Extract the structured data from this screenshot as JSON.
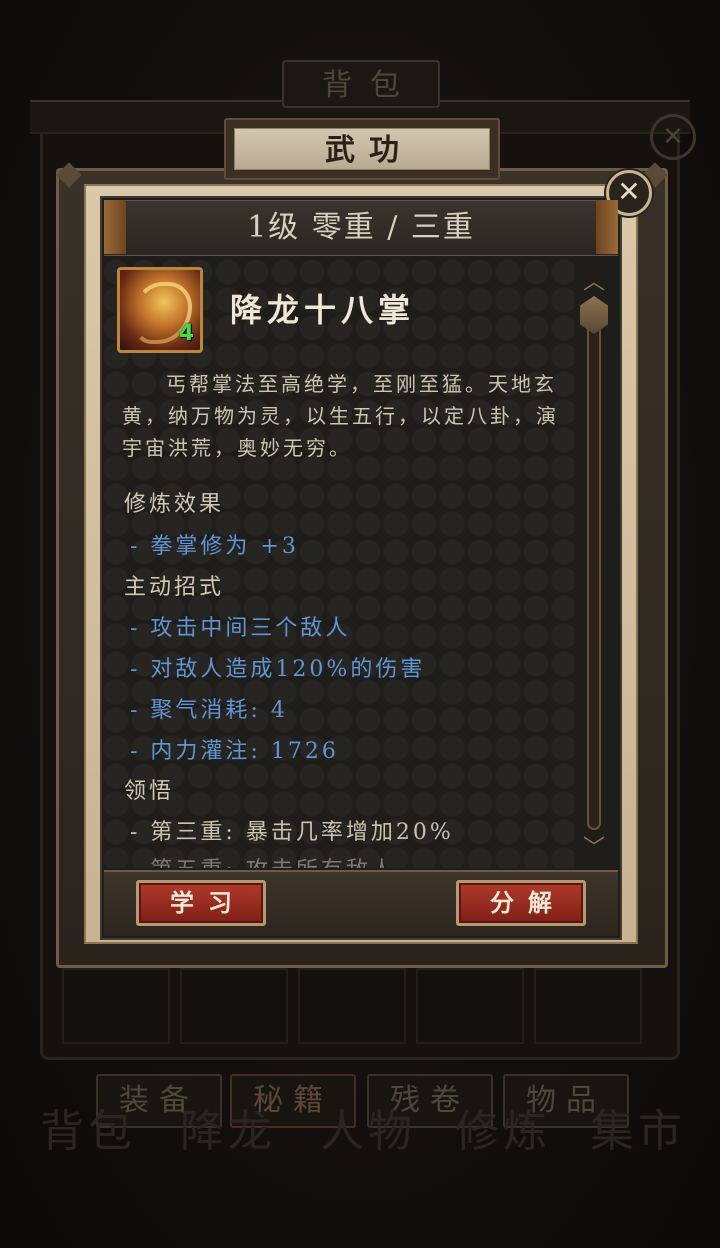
{
  "background": {
    "bag_title": "背包",
    "bag_tabs": [
      "装备",
      "秘籍",
      "残卷",
      "物品"
    ],
    "bottom_nav": [
      "背包",
      "降龙",
      "人物",
      "修炼",
      "集市"
    ]
  },
  "dialog": {
    "title": "武功",
    "level_text": "1级 零重 / 三重",
    "skill": {
      "name": "降龙十八掌",
      "icon": "dragon-palm-icon",
      "count": "4",
      "description": "丐帮掌法至高绝学，至刚至猛。天地玄黄，纳万物为灵，以生五行，以定八卦，演宇宙洪荒，奥妙无穷。"
    },
    "sections": {
      "effect_title": "修炼效果",
      "effect_items": [
        "- 拳掌修为 +3"
      ],
      "active_title": "主动招式",
      "active_items": [
        "- 攻击中间三个敌人",
        "- 对敌人造成120%的伤害",
        "- 聚气消耗: 4",
        "- 内力灌注: 1726"
      ],
      "insight_title": "领悟",
      "insight_items": [
        "- 第三重: 暴击几率增加20%",
        "- 第五重: 攻击所有敌人"
      ]
    },
    "buttons": {
      "learn": "学习",
      "decompose": "分解"
    }
  },
  "colors": {
    "accent_blue": "#5f95d4",
    "button_red": "#a8352a",
    "skill_count_green": "#3fe03a"
  }
}
